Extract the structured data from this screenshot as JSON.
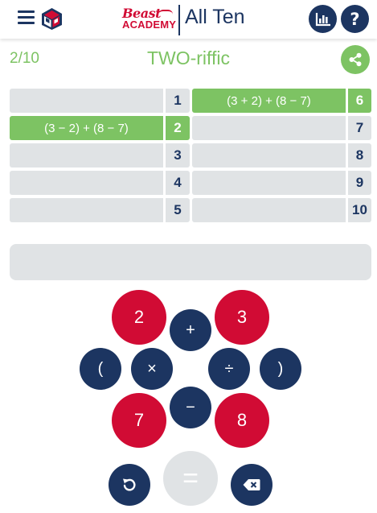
{
  "header": {
    "logo_line1": "Beast",
    "logo_line2": "ACADEMY",
    "title": "All Ten"
  },
  "puzzle": {
    "progress": "2/10",
    "title": "TWO-riffic"
  },
  "slots": [
    {
      "number": "1",
      "expression": "",
      "solved": false
    },
    {
      "number": "2",
      "expression": "(3 − 2) + (8 − 7)",
      "solved": true
    },
    {
      "number": "3",
      "expression": "",
      "solved": false
    },
    {
      "number": "4",
      "expression": "",
      "solved": false
    },
    {
      "number": "5",
      "expression": "",
      "solved": false
    },
    {
      "number": "6",
      "expression": "(3 + 2) + (8 − 7)",
      "solved": true
    },
    {
      "number": "7",
      "expression": "",
      "solved": false
    },
    {
      "number": "8",
      "expression": "",
      "solved": false
    },
    {
      "number": "9",
      "expression": "",
      "solved": false
    },
    {
      "number": "10",
      "expression": "",
      "solved": false
    }
  ],
  "expression_input": "",
  "keypad": {
    "numbers": [
      "2",
      "3",
      "7",
      "8"
    ],
    "plus": "+",
    "minus": "−",
    "times": "×",
    "divide": "÷",
    "open_paren": "(",
    "close_paren": ")",
    "equals": "="
  },
  "colors": {
    "navy": "#1c3561",
    "red": "#d10b34",
    "green": "#7dc363",
    "gray": "#e0e3e5"
  }
}
